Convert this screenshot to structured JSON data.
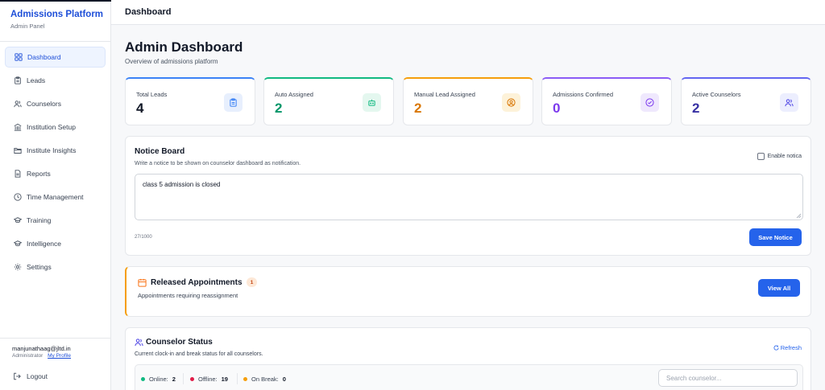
{
  "sidebar": {
    "brand_title": "Admissions Platform",
    "brand_subtitle": "Admin Panel",
    "items": [
      {
        "label": "Dashboard",
        "icon": "grid-icon",
        "active": true
      },
      {
        "label": "Leads",
        "icon": "clipboard-icon"
      },
      {
        "label": "Counselors",
        "icon": "users-icon"
      },
      {
        "label": "Institution Setup",
        "icon": "building-icon"
      },
      {
        "label": "Institute Insights",
        "icon": "folder-icon"
      },
      {
        "label": "Reports",
        "icon": "document-icon"
      },
      {
        "label": "Time Management",
        "icon": "clock-icon"
      },
      {
        "label": "Training",
        "icon": "graduation-cap-icon"
      },
      {
        "label": "Intelligence",
        "icon": "graduation-cap-icon"
      },
      {
        "label": "Settings",
        "icon": "gear-icon"
      }
    ],
    "user_email": "manjunathaag@jltd.in",
    "user_role": "Administrator",
    "my_profile": "My Profile",
    "logout": "Logout"
  },
  "header": {
    "title": "Dashboard"
  },
  "main": {
    "title": "Admin Dashboard",
    "subtitle": "Overview of admissions platform",
    "stats": [
      {
        "label": "Total Leads",
        "value": "4",
        "color": "#3b82f6",
        "value_color": "#111827",
        "icon": "clipboard-icon"
      },
      {
        "label": "Auto Assigned",
        "value": "2",
        "color": "#10b981",
        "value_color": "#059669",
        "icon": "robot-icon"
      },
      {
        "label": "Manual Lead Assigned",
        "value": "2",
        "color": "#f59e0b",
        "value_color": "#d97706",
        "icon": "user-circle-icon"
      },
      {
        "label": "Admissions Confirmed",
        "value": "0",
        "color": "#8b5cf6",
        "value_color": "#7c3aed",
        "icon": "check-circle-icon"
      },
      {
        "label": "Active Counselors",
        "value": "2",
        "color": "#6366f1",
        "value_color": "#3730a3",
        "icon": "users-icon"
      }
    ],
    "notice": {
      "title": "Notice Board",
      "description": "Write a notice to be shown on counselor dashboard as notification.",
      "enable_label": "Enable notica",
      "text": "class 5 admission is closed",
      "counter": "27/1000",
      "save_label": "Save Notice"
    },
    "appointments": {
      "title": "Released Appointments",
      "badge": "1",
      "description": "Appointments requiring reassignment",
      "view_all": "View All"
    },
    "counselor_status": {
      "title": "Counselor Status",
      "description": "Current clock-in and break status for all counselors.",
      "refresh": "Refresh",
      "online_label": "Online:",
      "online_value": "2",
      "offline_label": "Offline:",
      "offline_value": "19",
      "break_label": "On Break:",
      "break_value": "0",
      "search_placeholder": "Search counselor..."
    }
  },
  "colors": {
    "accent": "#2563eb",
    "online": "#10b981",
    "offline": "#e11d48",
    "on_break": "#f59e0b"
  }
}
